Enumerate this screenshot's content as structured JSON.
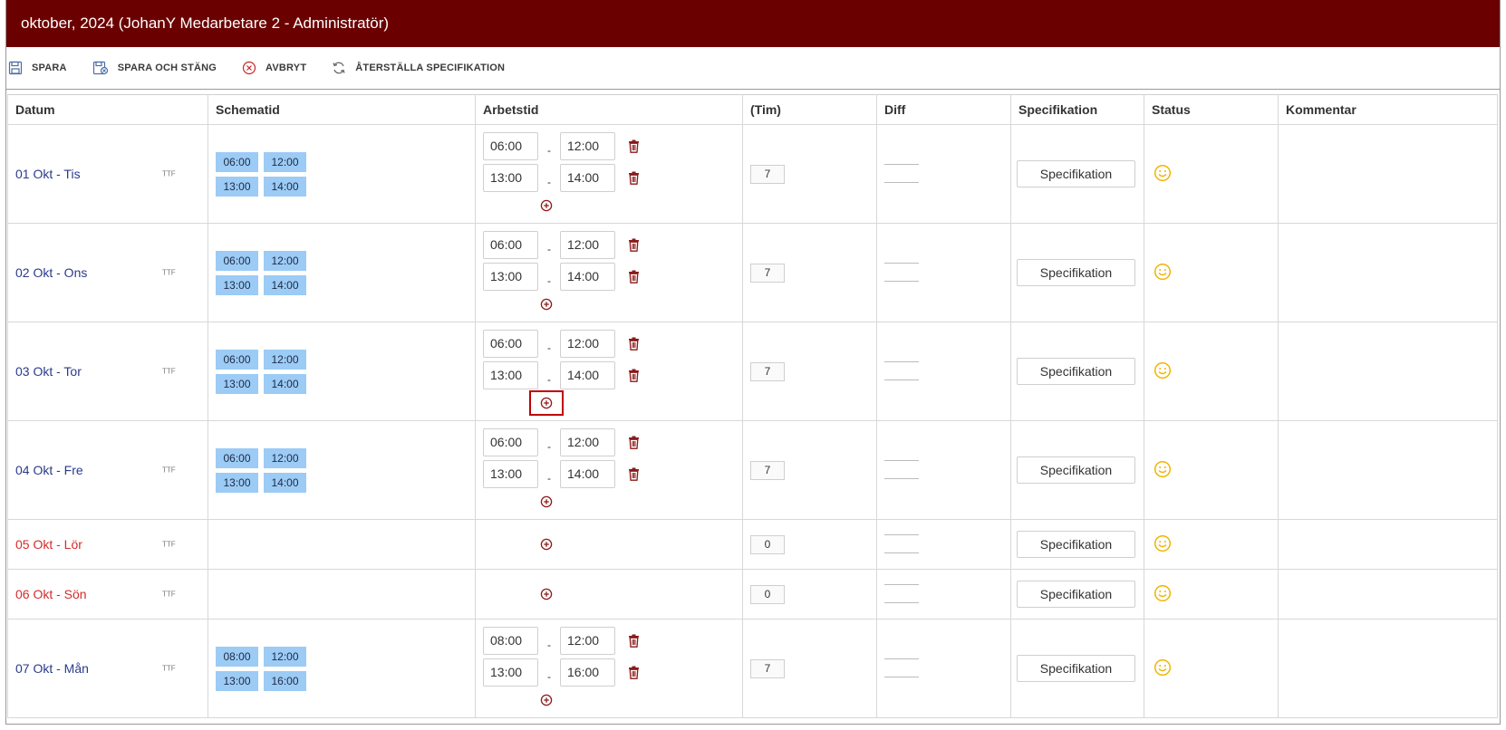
{
  "title": "oktober, 2024 (JohanY Medarbetare 2 - Administratör)",
  "toolbar": {
    "save": "SPARA",
    "save_close": "SPARA OCH STÄNG",
    "cancel": "AVBRYT",
    "reset_spec": "ÅTERSTÄLLA SPECIFIKATION"
  },
  "columns": {
    "datum": "Datum",
    "schematid": "Schematid",
    "arbetstid": "Arbetstid",
    "tim": "(Tim)",
    "diff": "Diff",
    "specifikation": "Specifikation",
    "status": "Status",
    "kommentar": "Kommentar"
  },
  "ttf_label": "TTF",
  "spec_label": "Specifikation",
  "colors": {
    "titlebar": "#6b0000",
    "chip": "#9ccbf5",
    "weekday": "#2b3a8a",
    "weekend": "#d42b2b",
    "icon": "#8b1a1a",
    "smiley": "#f0b400"
  },
  "rows": [
    {
      "date": "01 Okt - Tis",
      "weekend": false,
      "schedule": [
        [
          "06:00",
          "12:00"
        ],
        [
          "13:00",
          "14:00"
        ]
      ],
      "work": [
        [
          "06:00",
          "12:00"
        ],
        [
          "13:00",
          "14:00"
        ]
      ],
      "tim": "7",
      "highlight_add": false
    },
    {
      "date": "02 Okt - Ons",
      "weekend": false,
      "schedule": [
        [
          "06:00",
          "12:00"
        ],
        [
          "13:00",
          "14:00"
        ]
      ],
      "work": [
        [
          "06:00",
          "12:00"
        ],
        [
          "13:00",
          "14:00"
        ]
      ],
      "tim": "7",
      "highlight_add": false
    },
    {
      "date": "03 Okt - Tor",
      "weekend": false,
      "schedule": [
        [
          "06:00",
          "12:00"
        ],
        [
          "13:00",
          "14:00"
        ]
      ],
      "work": [
        [
          "06:00",
          "12:00"
        ],
        [
          "13:00",
          "14:00"
        ]
      ],
      "tim": "7",
      "highlight_add": true
    },
    {
      "date": "04 Okt - Fre",
      "weekend": false,
      "schedule": [
        [
          "06:00",
          "12:00"
        ],
        [
          "13:00",
          "14:00"
        ]
      ],
      "work": [
        [
          "06:00",
          "12:00"
        ],
        [
          "13:00",
          "14:00"
        ]
      ],
      "tim": "7",
      "highlight_add": false
    },
    {
      "date": "05 Okt - Lör",
      "weekend": true,
      "schedule": [],
      "work": [],
      "tim": "0",
      "highlight_add": false
    },
    {
      "date": "06 Okt - Sön",
      "weekend": true,
      "schedule": [],
      "work": [],
      "tim": "0",
      "highlight_add": false
    },
    {
      "date": "07 Okt - Mån",
      "weekend": false,
      "schedule": [
        [
          "08:00",
          "12:00"
        ],
        [
          "13:00",
          "16:00"
        ]
      ],
      "work": [
        [
          "08:00",
          "12:00"
        ],
        [
          "13:00",
          "16:00"
        ]
      ],
      "tim": "7",
      "highlight_add": false
    }
  ]
}
